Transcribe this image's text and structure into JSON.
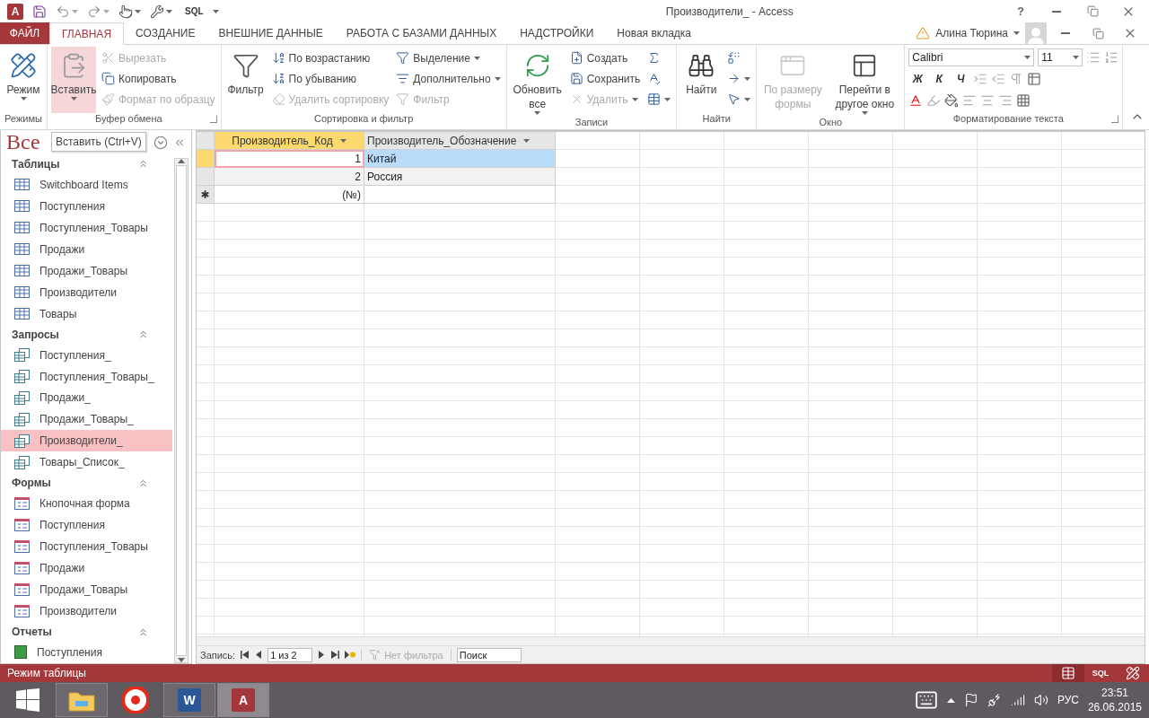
{
  "quick_access": {
    "logo_letter": "A",
    "sql_label": "SQL"
  },
  "window_title": "Производители_ - Access",
  "help_label": "?",
  "tabs": [
    {
      "label": "ФАЙЛ",
      "kind": "file",
      "selected": false
    },
    {
      "label": "ГЛАВНАЯ",
      "kind": "tab",
      "selected": true
    },
    {
      "label": "СОЗДАНИЕ",
      "kind": "tab",
      "selected": false
    },
    {
      "label": "ВНЕШНИЕ ДАННЫЕ",
      "kind": "tab",
      "selected": false
    },
    {
      "label": "РАБОТА С БАЗАМИ ДАННЫХ",
      "kind": "tab",
      "selected": false
    },
    {
      "label": "НАДСТРОЙКИ",
      "kind": "tab",
      "selected": false
    },
    {
      "label": "Новая вкладка",
      "kind": "tab",
      "selected": false
    }
  ],
  "user": {
    "name": "Алина Тюрина"
  },
  "ribbon": {
    "groups": [
      {
        "kind": "buttons",
        "label": "Режимы",
        "launcher": false,
        "large": [
          {
            "label": "Режим",
            "dropdown": true,
            "disabled": false,
            "highlighted": false
          }
        ]
      },
      {
        "kind": "buttons",
        "label": "Буфер обмена",
        "launcher": true,
        "large": [
          {
            "label": "Вставить",
            "dropdown": true,
            "disabled": false,
            "highlighted": true
          }
        ],
        "columns": [
          [
            {
              "label": "Вырезать",
              "dropdown": false,
              "disabled": true
            },
            {
              "label": "Копировать",
              "dropdown": false,
              "disabled": false
            },
            {
              "label": "Формат по образцу",
              "dropdown": false,
              "disabled": true
            }
          ]
        ]
      },
      {
        "kind": "buttons",
        "label": "Сортировка и фильтр",
        "launcher": false,
        "large": [
          {
            "label": "Фильтр",
            "dropdown": false,
            "disabled": false,
            "highlighted": false
          }
        ],
        "columns": [
          [
            {
              "label": "По возрастанию",
              "dropdown": false,
              "disabled": false
            },
            {
              "label": "По убыванию",
              "dropdown": false,
              "disabled": false
            },
            {
              "label": "Удалить сортировку",
              "dropdown": false,
              "disabled": true
            }
          ],
          [
            {
              "label": "Выделение",
              "dropdown": true,
              "disabled": false
            },
            {
              "label": "Дополнительно",
              "dropdown": true,
              "disabled": false
            },
            {
              "label": "Фильтр",
              "dropdown": false,
              "disabled": true
            }
          ]
        ]
      },
      {
        "kind": "buttons",
        "label": "Записи",
        "launcher": false,
        "large": [
          {
            "label": "Обновить все",
            "dropdown": true,
            "disabled": false,
            "highlighted": false
          }
        ],
        "columns": [
          [
            {
              "label": "Создать",
              "dropdown": false,
              "disabled": false
            },
            {
              "label": "Сохранить",
              "dropdown": false,
              "disabled": false
            },
            {
              "label": "Удалить",
              "dropdown": true,
              "disabled": true
            }
          ],
          [
            {
              "dropdown": false,
              "disabled": false
            },
            {
              "dropdown": false,
              "disabled": false
            },
            {
              "dropdown": true,
              "disabled": false
            }
          ]
        ]
      },
      {
        "kind": "buttons",
        "label": "Найти",
        "launcher": false,
        "large": [
          {
            "label": "Найти",
            "dropdown": false,
            "disabled": false,
            "highlighted": false
          }
        ],
        "columns": [
          [
            {
              "dropdown": false,
              "disabled": false
            },
            {
              "dropdown": true,
              "disabled": false
            },
            {
              "dropdown": true,
              "disabled": false
            }
          ]
        ]
      },
      {
        "kind": "buttons",
        "label": "Окно",
        "launcher": false,
        "large": [
          {
            "label": "По размеру формы",
            "dropdown": false,
            "disabled": true,
            "highlighted": false
          },
          {
            "label": "Перейти в другое окно",
            "dropdown": true,
            "disabled": false,
            "highlighted": false
          }
        ]
      },
      {
        "kind": "formatting",
        "label": "Форматирование текста",
        "launcher": true,
        "font": "Calibri",
        "size": "11",
        "style_buttons": [
          "Ж",
          "К",
          "Ч"
        ]
      }
    ]
  },
  "tooltip": "Вставить (Ctrl+V)",
  "nav_pane": {
    "title": "Все",
    "groups": [
      {
        "label": "Таблицы",
        "kind": "table",
        "items": [
          {
            "label": "Switchboard Items",
            "selected": false
          },
          {
            "label": "Поступления",
            "selected": false
          },
          {
            "label": "Поступления_Товары",
            "selected": false
          },
          {
            "label": "Продажи",
            "selected": false
          },
          {
            "label": "Продажи_Товары",
            "selected": false
          },
          {
            "label": "Производители",
            "selected": false
          },
          {
            "label": "Товары",
            "selected": false
          }
        ]
      },
      {
        "label": "Запросы",
        "kind": "query",
        "items": [
          {
            "label": "Поступления_",
            "selected": false
          },
          {
            "label": "Поступления_Товары_",
            "selected": false
          },
          {
            "label": "Продажи_",
            "selected": false
          },
          {
            "label": "Продажи_Товары_",
            "selected": false
          },
          {
            "label": "Производители_",
            "selected": true
          },
          {
            "label": "Товары_Список_",
            "selected": false
          }
        ]
      },
      {
        "label": "Формы",
        "kind": "form",
        "items": [
          {
            "label": "Кнопочная форма",
            "selected": false
          },
          {
            "label": "Поступления",
            "selected": false
          },
          {
            "label": "Поступления_Товары",
            "selected": false
          },
          {
            "label": "Продажи",
            "selected": false
          },
          {
            "label": "Продажи_Товары",
            "selected": false
          },
          {
            "label": "Производители",
            "selected": false
          }
        ]
      },
      {
        "label": "Отчеты",
        "kind": "report",
        "items": [
          {
            "label": "Поступления",
            "selected": false
          }
        ]
      }
    ]
  },
  "datasheet": {
    "columns": [
      {
        "label": "Производитель_Код",
        "selected": true
      },
      {
        "label": "Производитель_Обозначение",
        "selected": false
      }
    ],
    "rows": [
      {
        "cells": [
          "1",
          "Китай"
        ],
        "selected": true
      },
      {
        "cells": [
          "2",
          "Россия"
        ],
        "selected": false
      }
    ],
    "new_row": {
      "marker": "✱",
      "cells": [
        "(№)"
      ]
    }
  },
  "record_nav": {
    "label": "Запись:",
    "position": "1 из 2",
    "filter": "Нет фильтра",
    "search_placeholder": "Поиск"
  },
  "status_bar": {
    "text": "Режим таблицы",
    "views": [
      {
        "kind": "datasheet",
        "selected": true
      },
      {
        "kind": "sql",
        "label": "SQL",
        "selected": false
      },
      {
        "kind": "design",
        "selected": false
      }
    ]
  },
  "taskbar": {
    "apps": [
      {
        "kind": "start",
        "open": false,
        "active": false
      },
      {
        "kind": "explorer",
        "open": true,
        "active": false
      },
      {
        "kind": "browser",
        "open": false,
        "active": false
      },
      {
        "kind": "word",
        "letter": "W",
        "open": true,
        "active": false
      },
      {
        "kind": "access",
        "letter": "A",
        "open": true,
        "active": true
      }
    ],
    "tray": {
      "language": "РУС",
      "time": "23:51",
      "date": "26.06.2015"
    }
  }
}
